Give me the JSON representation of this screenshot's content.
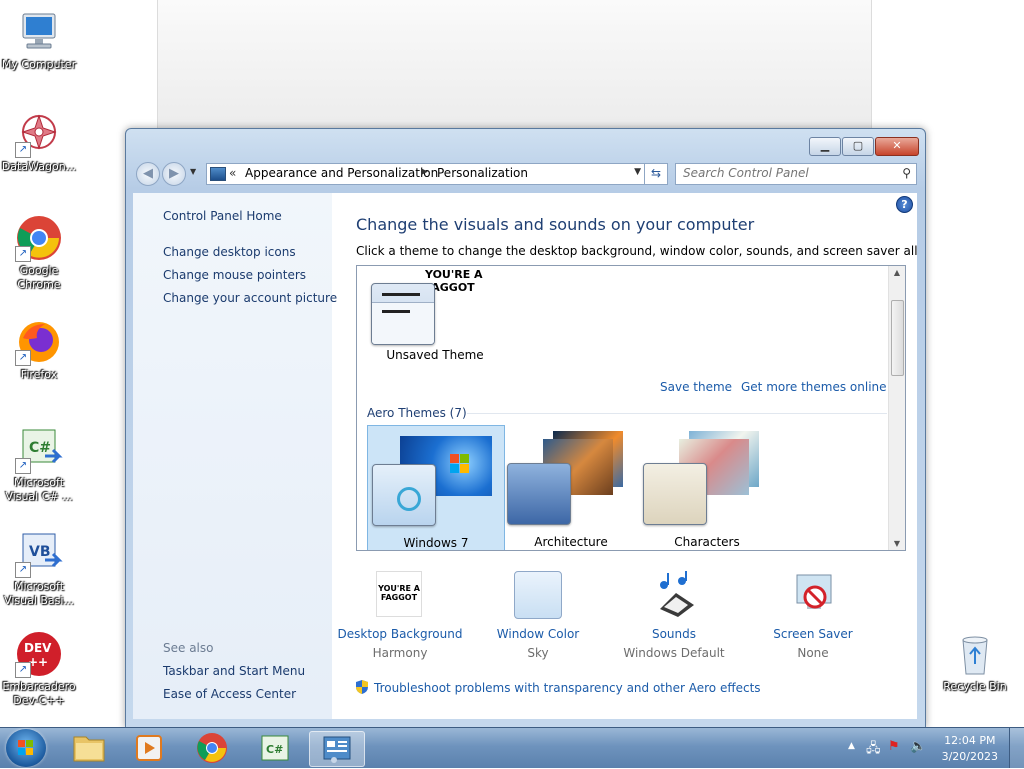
{
  "desktop": {
    "icons": [
      {
        "label": "My Computer"
      },
      {
        "label": "DataWagon..."
      },
      {
        "label": "Google Chrome"
      },
      {
        "label": "Firefox"
      },
      {
        "label": "Microsoft Visual C# ..."
      },
      {
        "label": "Microsoft Visual Basi..."
      },
      {
        "label": "Embarcadero Dev-C++"
      },
      {
        "label": "Recycle Bin"
      }
    ]
  },
  "window": {
    "address": {
      "crumbs": [
        "Appearance and Personalization",
        "Personalization"
      ],
      "overflow_glyph": "«"
    },
    "search": {
      "placeholder": "Search Control Panel"
    },
    "left_pane": {
      "home_link": "Control Panel Home",
      "links": [
        "Change desktop icons",
        "Change mouse pointers",
        "Change your account picture"
      ],
      "see_also_title": "See also",
      "see_also_links": [
        "Taskbar and Start Menu",
        "Ease of Access Center"
      ]
    },
    "main": {
      "heading": "Change the visuals and sounds on your computer",
      "subheading": "Click a theme to change the desktop background, window color, sounds, and screen saver all at once.",
      "my_themes": {
        "unsaved_theme": "Unsaved Theme",
        "thumb_text_line1": "YOU'RE A",
        "thumb_text_line2": "FAGGOT",
        "save_theme": "Save theme",
        "get_more": "Get more themes online"
      },
      "aero_group_title": "Aero Themes (7)",
      "aero_themes": [
        {
          "name": "Windows 7",
          "selected": true
        },
        {
          "name": "Architecture",
          "selected": false
        },
        {
          "name": "Characters",
          "selected": false
        }
      ],
      "bottom_items": [
        {
          "label": "Desktop Background",
          "value": "Harmony"
        },
        {
          "label": "Window Color",
          "value": "Sky"
        },
        {
          "label": "Sounds",
          "value": "Windows Default"
        },
        {
          "label": "Screen Saver",
          "value": "None"
        }
      ],
      "troubleshoot_link": "Troubleshoot problems with transparency and other Aero effects"
    }
  },
  "taskbar": {
    "clock_time": "12:04 PM",
    "clock_date": "3/20/2023"
  },
  "colors": {
    "link": "#1b5ba9",
    "heading": "#1f3f73",
    "selection": "#cce4f7"
  }
}
